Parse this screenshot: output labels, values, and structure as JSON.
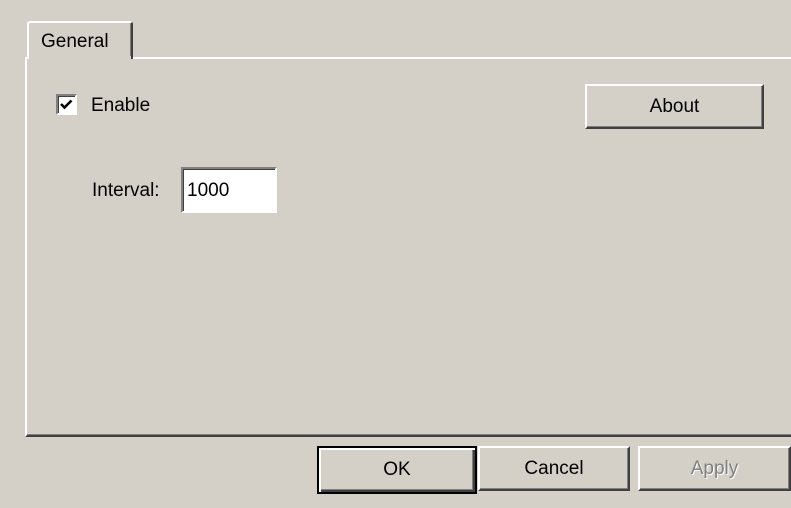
{
  "tabs": [
    {
      "label": "General",
      "selected": true
    }
  ],
  "general": {
    "enable": {
      "label": "Enable",
      "checked": true
    },
    "about_label": "About",
    "interval": {
      "label": "Interval:",
      "value": "1000"
    }
  },
  "footer": {
    "ok_label": "OK",
    "cancel_label": "Cancel",
    "apply_label": "Apply"
  },
  "colors": {
    "face": "#d4d0c8",
    "disabled_text": "#808080"
  }
}
